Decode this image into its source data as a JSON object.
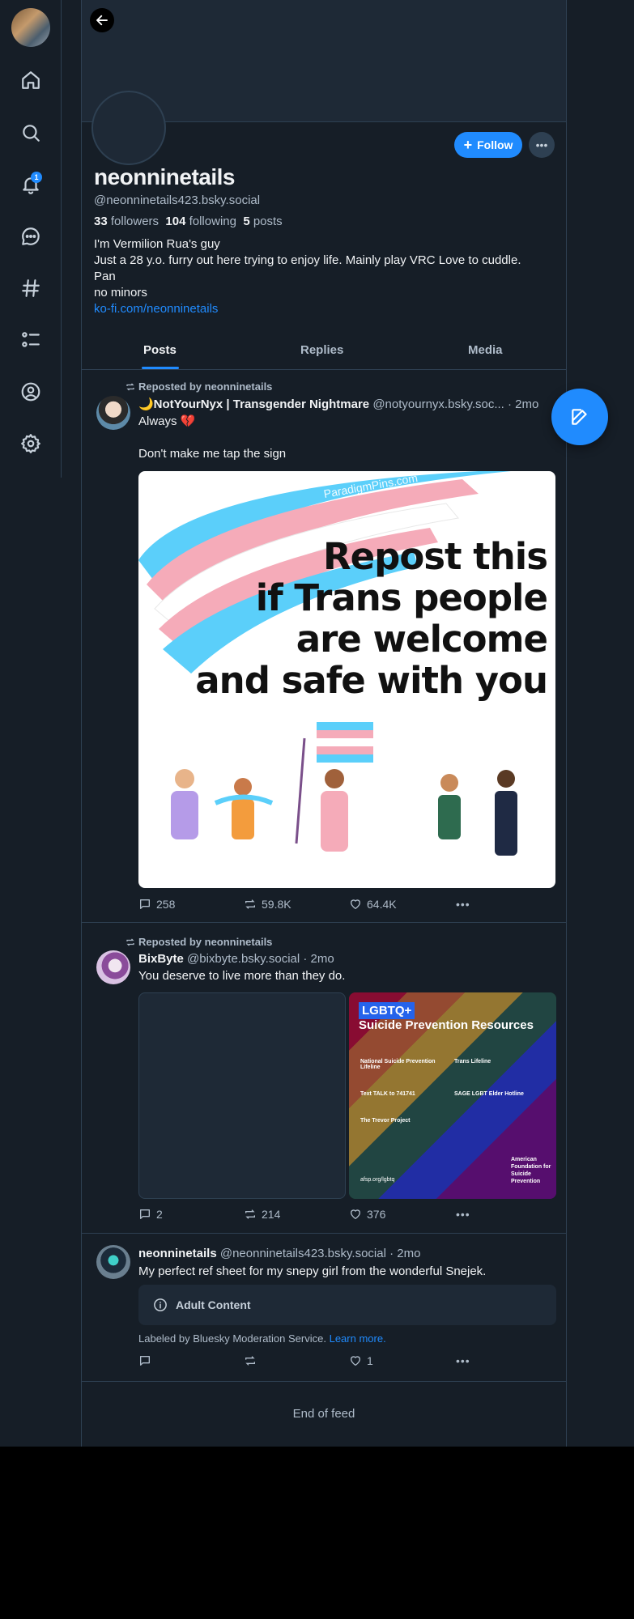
{
  "profile": {
    "display_name": "neonninetails",
    "handle": "@neonninetails423.bsky.social",
    "followers_count": "33",
    "followers_label": "followers",
    "following_count": "104",
    "following_label": "following",
    "posts_count": "5",
    "posts_label": "posts",
    "bio_lines": [
      "I'm Vermilion Rua's guy",
      "Just a 28 y.o. furry out here trying to enjoy life.  Mainly play VRC Love to cuddle.",
      "Pan",
      "no minors"
    ],
    "bio_link": "ko-fi.com/neonninetails",
    "follow_label": "Follow"
  },
  "nav": {
    "notification_badge": "1",
    "icons": [
      "home-icon",
      "search-icon",
      "bell-icon",
      "chat-icon",
      "hashtag-icon",
      "list-icon",
      "profile-icon",
      "gear-icon"
    ]
  },
  "tabs": [
    {
      "label": "Posts"
    },
    {
      "label": "Replies"
    },
    {
      "label": "Media"
    }
  ],
  "posts": [
    {
      "repost_label": "Reposted by neonninetails",
      "author_name": "🌙NotYourNyx | Transgender Nightmare",
      "author_meta": "@notyournyx.bsky.soc... · 2mo",
      "text_line1": "Always 💔",
      "text_line2": "Don't make me tap the sign",
      "image_text": [
        "Repost this",
        "if Trans people",
        "are welcome",
        "and safe with you"
      ],
      "image_watermark": "ParadigmPins.com",
      "replies": "258",
      "reposts": "59.8K",
      "likes": "64.4K"
    },
    {
      "repost_label": "Reposted by neonninetails",
      "author_name": "BixByte",
      "author_meta": "@bixbyte.bsky.social · 2mo",
      "text": "You deserve to live more than they do.",
      "image_badge": "LGBTQ+",
      "image_title": "Suicide Prevention Resources",
      "image_items": [
        "National Suicide Prevention Lifeline",
        "Trans Lifeline",
        "Text TALK to 741741",
        "SAGE LGBT Elder Hotline",
        "The Trevor Project"
      ],
      "image_footer": "afsp.org/lgbtq",
      "image_org": "American Foundation for Suicide Prevention",
      "replies": "2",
      "reposts": "214",
      "likes": "376"
    },
    {
      "author_name": "neonninetails",
      "author_meta": "@neonninetails423.bsky.social · 2mo",
      "text": "My perfect ref sheet for my snepy girl from the wonderful Snejek.",
      "warning": "Adult Content",
      "label_note": "Labeled by Bluesky Moderation Service.",
      "label_link": "Learn more.",
      "replies": "",
      "reposts": "",
      "likes": "1"
    }
  ],
  "end_of_feed": "End of feed",
  "colors": {
    "accent": "#208bfe",
    "background": "#161e27",
    "border": "#2e4052",
    "muted": "#aebbc9"
  }
}
